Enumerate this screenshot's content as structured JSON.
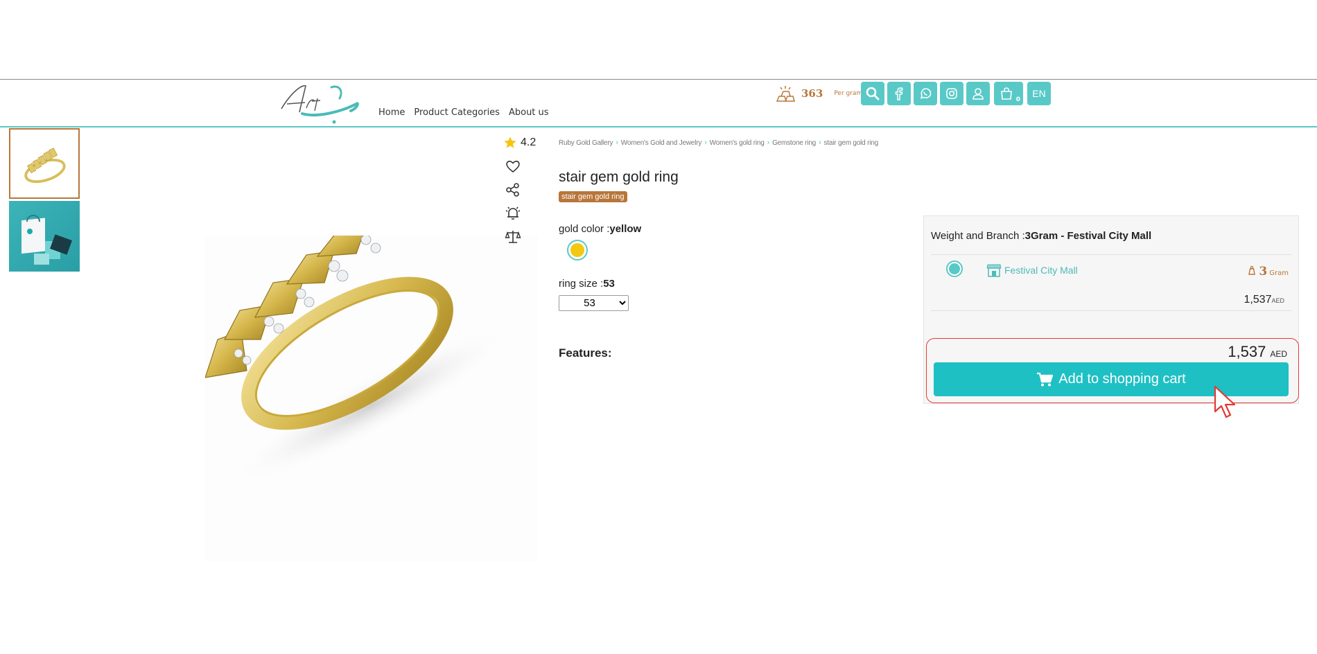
{
  "header": {
    "nav": [
      "Home",
      "Product Categories",
      "About us"
    ],
    "gold_price": "363",
    "gold_price_unit": "Per gram",
    "cart_count": "0",
    "language": "EN",
    "accent_color": "#59c9c7",
    "gold_color": "#b8763a",
    "icons": [
      "gold-bars-icon",
      "search-icon",
      "facebook-icon",
      "whatsapp-icon",
      "instagram-icon",
      "user-icon",
      "shopping-bag-icon"
    ]
  },
  "product": {
    "rating": "4.2",
    "breadcrumb": [
      "Ruby Gold Gallery",
      "Women's Gold and Jewelry",
      "Women's gold ring",
      "Gemstone ring",
      "stair gem gold ring"
    ],
    "title": "stair gem gold ring",
    "tag": "stair gem gold ring",
    "gold_color_label": "gold color :",
    "gold_color_value": "yellow",
    "ring_size_label": "ring size :",
    "ring_size_value": "53",
    "ring_size_options": [
      "53"
    ],
    "features_label": "Features:"
  },
  "panel": {
    "heading_label": "Weight and Branch :",
    "heading_value": "3Gram - Festival City Mall",
    "branch_name": "Festival City Mall",
    "weight_value": "3",
    "weight_unit": "Gram",
    "row_price": "1,537",
    "row_currency": "AED",
    "total_price": "1,537",
    "total_currency": "AED",
    "add_to_cart": "Add to shopping cart"
  }
}
